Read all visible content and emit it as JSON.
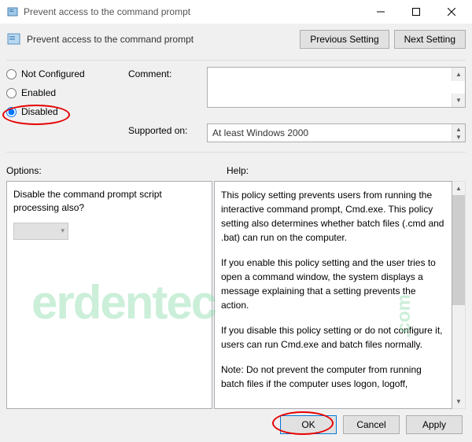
{
  "title": "Prevent access to the command prompt",
  "header": {
    "title": "Prevent access to the command prompt",
    "prev": "Previous Setting",
    "next": "Next Setting"
  },
  "radios": {
    "not_configured": "Not Configured",
    "enabled": "Enabled",
    "disabled": "Disabled"
  },
  "comment_label": "Comment:",
  "supported_label": "Supported on:",
  "supported_value": "At least Windows 2000",
  "options_label": "Options:",
  "help_label": "Help:",
  "option_text": "Disable the command prompt script processing also?",
  "help_p1": "This policy setting prevents users from running the interactive command prompt, Cmd.exe.  This policy setting also determines whether batch files (.cmd and .bat) can run on the computer.",
  "help_p2": "If you enable this policy setting and the user tries to open a command window, the system displays a message explaining that a setting prevents the action.",
  "help_p3": "If you disable this policy setting or do not configure it, users can run Cmd.exe and batch files normally.",
  "help_p4": "Note: Do not prevent the computer from running batch files if the computer uses logon, logoff,",
  "footer": {
    "ok": "OK",
    "cancel": "Cancel",
    "apply": "Apply"
  },
  "watermark": "erdentec",
  "watermark2": ".com"
}
